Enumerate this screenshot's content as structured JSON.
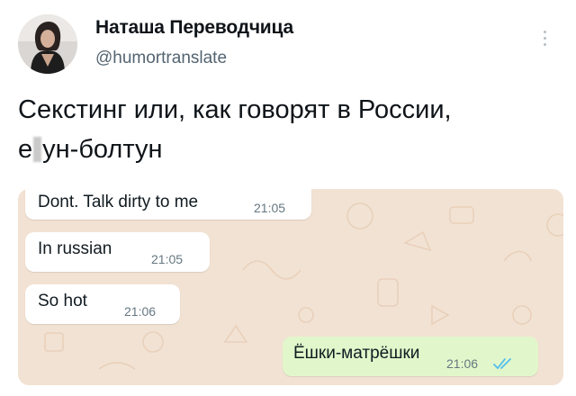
{
  "tweet": {
    "author": {
      "name": "Наташа Переводчица",
      "handle": "@humortranslate",
      "avatar_icon": "avatar-photo"
    },
    "text_line1": "Секстинг или, как говорят в России,",
    "text_line2_prefix": "е",
    "text_line2_suffix": "ун-болтун",
    "more_icon": "vertical-dots"
  },
  "chat": {
    "background_color": "#f2e2d3",
    "messages": [
      {
        "text": "Dont. Talk dirty to me",
        "time": "21:05",
        "direction": "incoming"
      },
      {
        "text": "In russian",
        "time": "21:05",
        "direction": "incoming"
      },
      {
        "text": "So hot",
        "time": "21:06",
        "direction": "incoming"
      },
      {
        "text": "Ёшки-матрёшки",
        "time": "21:06",
        "direction": "outgoing",
        "status": "read-double-check"
      }
    ]
  },
  "colors": {
    "name_text": "#0f1419",
    "handle_text": "#536471",
    "outgoing_bubble": "#e1f7cb",
    "incoming_bubble": "#ffffff",
    "read_ticks": "#53bdeb"
  }
}
